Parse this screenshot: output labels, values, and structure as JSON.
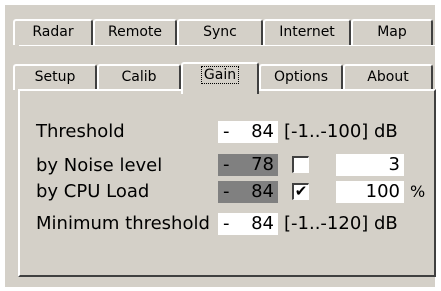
{
  "tabs_row1": [
    "Radar",
    "Remote",
    "Sync",
    "Internet",
    "Map"
  ],
  "tabs_row2": [
    "Setup",
    "Calib",
    "Gain",
    "Options",
    "About"
  ],
  "active_tab": "Gain",
  "gain": {
    "threshold_label": "Threshold",
    "threshold_value": "84",
    "threshold_range": "[-1..-100] dB",
    "noise_label": "by Noise level",
    "noise_value": "78",
    "noise_checked": false,
    "noise_factor": "3",
    "cpu_label": "by CPU Load",
    "cpu_value": "84",
    "cpu_checked": true,
    "cpu_factor": "100",
    "cpu_unit": "%",
    "min_label": "Minimum threshold",
    "min_value": "84",
    "min_range": "[-1..-120] dB",
    "minus": "-",
    "check_mark": "✔"
  }
}
